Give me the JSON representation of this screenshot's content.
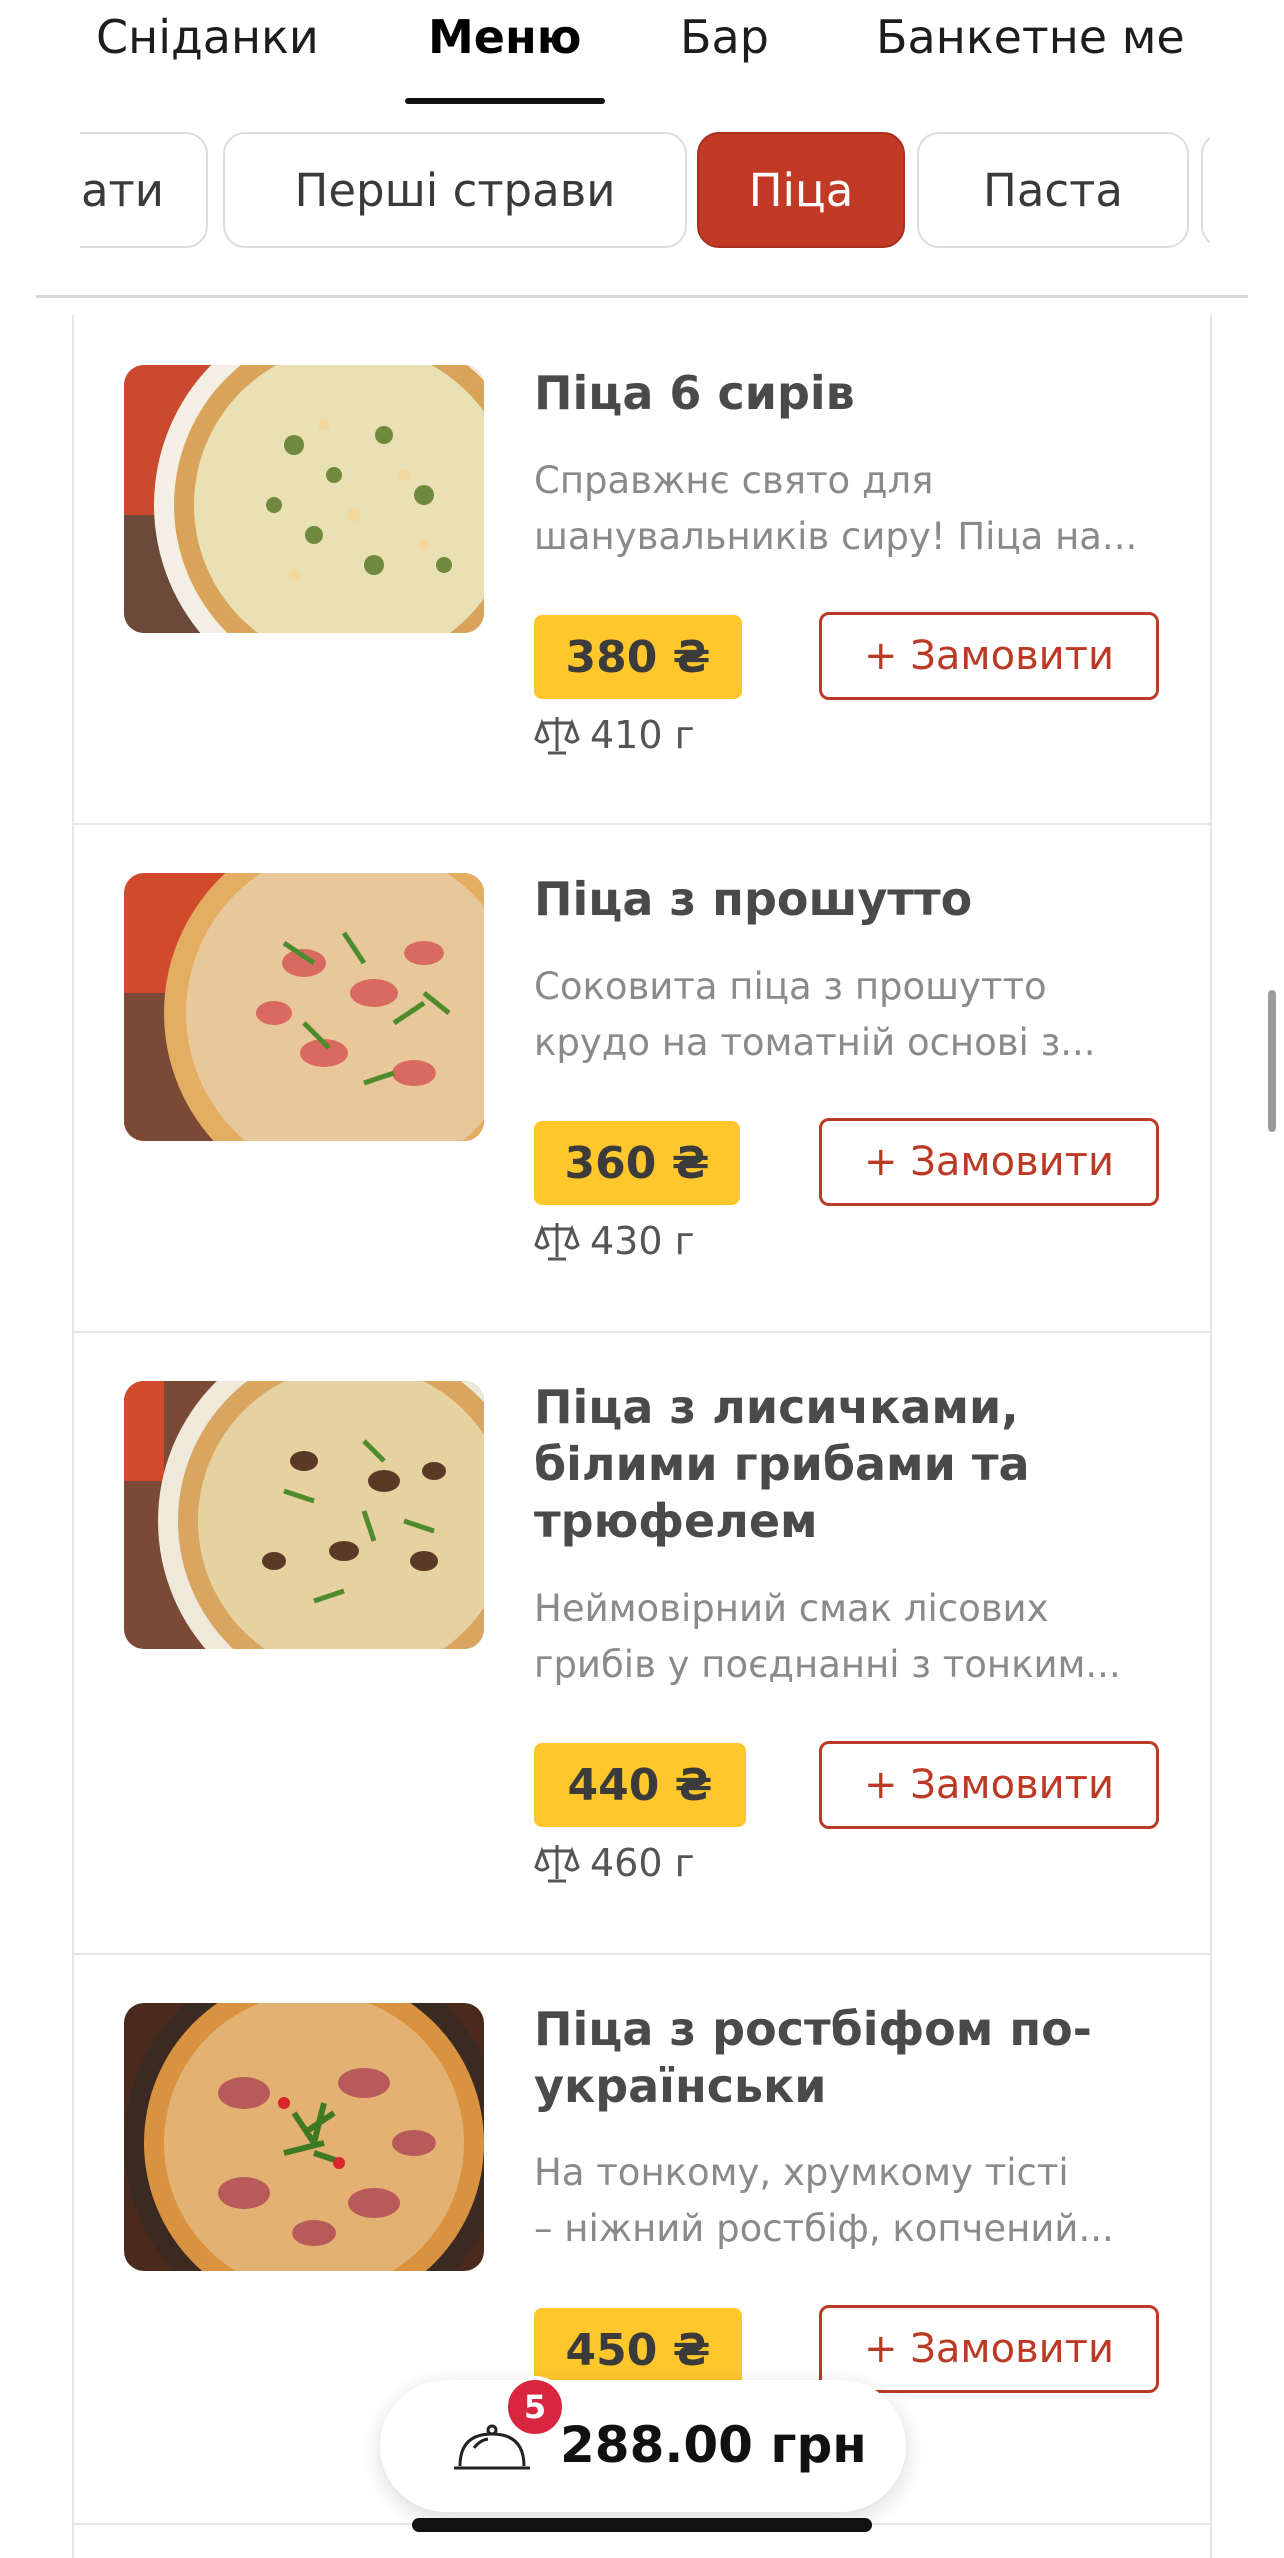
{
  "top_tabs": [
    {
      "label": "Сніданки"
    },
    {
      "label": "Меню"
    },
    {
      "label": "Бар"
    },
    {
      "label": "Банкетне ме"
    }
  ],
  "categories": [
    {
      "label": "ати"
    },
    {
      "label": "Перші страви"
    },
    {
      "label": "Піца"
    },
    {
      "label": "Паста"
    }
  ],
  "items": [
    {
      "title_lines": [
        "Піца 6 сирів"
      ],
      "desc_lines": [
        "Справжнє свято для",
        "шанувальників сиру! Піца на..."
      ],
      "price": "380 ₴",
      "order_label": "+ Замовити",
      "weight": "410 г"
    },
    {
      "title_lines": [
        "Піца з прошутто"
      ],
      "desc_lines": [
        "Соковита піца з прошутто",
        "крудо на томатній основі з..."
      ],
      "price": "360 ₴",
      "order_label": "+ Замовити",
      "weight": "430 г"
    },
    {
      "title_lines": [
        "Піца з лисичками,",
        "білими грибами та",
        "трюфелем"
      ],
      "desc_lines": [
        "Неймовірний смак лісових",
        "грибів у поєднанні з тонким..."
      ],
      "price": "440 ₴",
      "order_label": "+ Замовити",
      "weight": "460 г"
    },
    {
      "title_lines": [
        "Піца з ростбіфом по-",
        "українськи"
      ],
      "desc_lines": [
        "На тонкому, хрумкому тісті",
        "– ніжний ростбіф, копчений..."
      ],
      "price": "450 ₴",
      "order_label": "+ Замовити"
    }
  ],
  "cart": {
    "count": "5",
    "total": "288.00 грн"
  },
  "icons": {
    "weight": "scale-icon",
    "cart": "cloche-icon"
  },
  "colors": {
    "accent": "#c23a26",
    "price_bg": "#ffc72c",
    "badge": "#d8263f"
  }
}
